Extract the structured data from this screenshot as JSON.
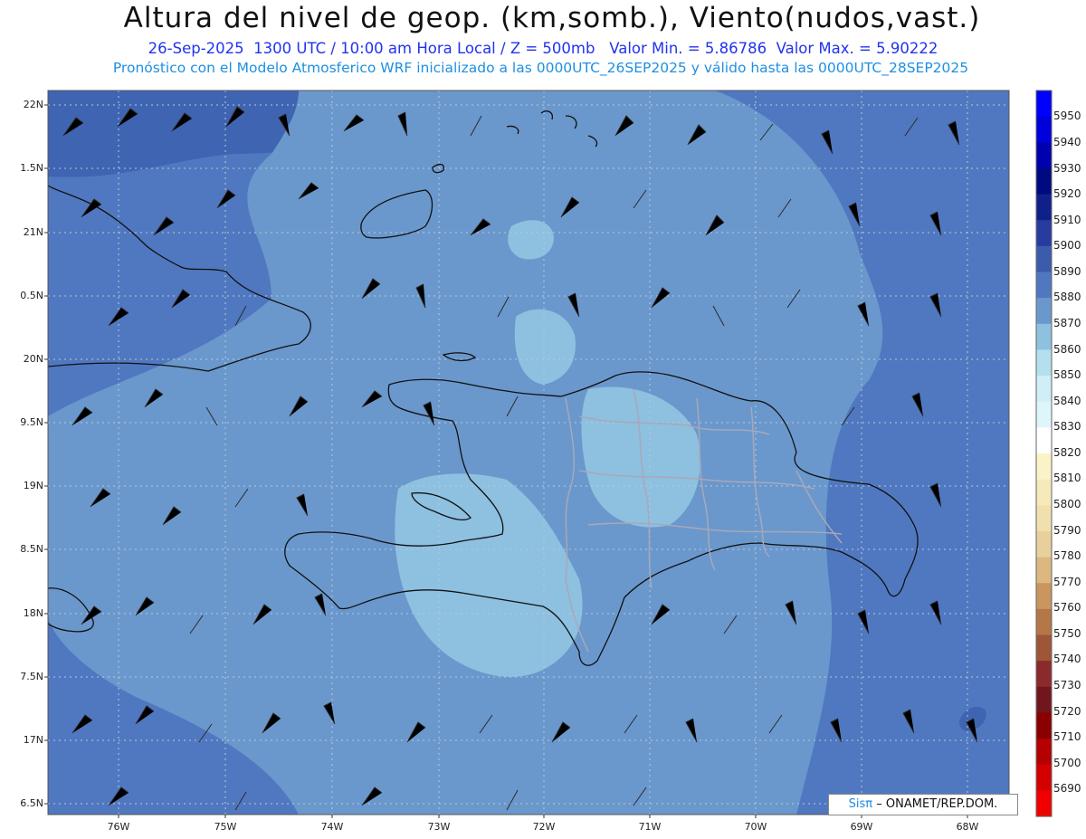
{
  "header": {
    "title": "Altura del nivel de geop. (km,somb.), Viento(nudos,vast.)",
    "subtitle1": "26-Sep-2025  1300 UTC / 10:00 am Hora Local / Z = 500mb   Valor Min. = 5.86786  Valor Max. = 5.90222",
    "subtitle2": "Pronóstico con el Modelo Atmosferico WRF inicializado a las 0000UTC_26SEP2025 y válido hasta las  0000UTC_28SEP2025"
  },
  "axes": {
    "lat_labels": [
      "22N",
      "1.5N",
      "21N",
      "0.5N",
      "20N",
      "9.5N",
      "19N",
      "8.5N",
      "18N",
      "7.5N",
      "17N",
      "6.5N"
    ],
    "lon_labels": [
      "76W",
      "75W",
      "74W",
      "73W",
      "72W",
      "71W",
      "70W",
      "69W",
      "68W"
    ]
  },
  "colorbar": {
    "labels": [
      "5950",
      "5940",
      "5930",
      "5920",
      "5910",
      "5900",
      "5890",
      "5880",
      "5870",
      "5860",
      "5850",
      "5840",
      "5830",
      "5820",
      "5810",
      "5800",
      "5790",
      "5780",
      "5770",
      "5760",
      "5750",
      "5740",
      "5730",
      "5720",
      "5710",
      "5700",
      "5690"
    ],
    "colors": [
      "#0000ff",
      "#0000dd",
      "#0000b0",
      "#000a80",
      "#10208a",
      "#283ca0",
      "#3a5cab",
      "#5078c0",
      "#6a98cc",
      "#8ec0e0",
      "#b4e0ee",
      "#cfeef5",
      "#def6f9",
      "#ffffff",
      "#fbf3c8",
      "#f6eabb",
      "#f0e0ae",
      "#e8d09c",
      "#dcb880",
      "#c9965f",
      "#b67748",
      "#9e5538",
      "#8a2a2c",
      "#70161c",
      "#8a0000",
      "#b40000",
      "#d40000",
      "#f00000"
    ]
  },
  "credit": {
    "logo_text": "Sisπ",
    "org_text": "– ONAMET/REP.DOM."
  }
}
